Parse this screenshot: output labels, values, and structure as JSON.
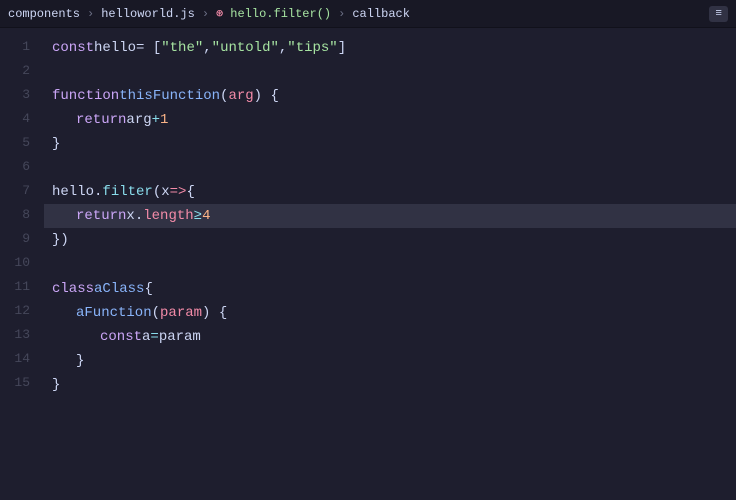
{
  "tabbar": {
    "breadcrumbs": [
      {
        "label": "components",
        "type": "folder"
      },
      {
        "label": "helloworld.js",
        "type": "file"
      },
      {
        "label": "hello.filter()",
        "type": "method"
      },
      {
        "label": "callback",
        "type": "text"
      }
    ],
    "top_right": "≡"
  },
  "lines": [
    {
      "num": 1,
      "tokens": [
        {
          "t": "kw-const",
          "v": "const"
        },
        {
          "t": "var-name",
          "v": " hello "
        },
        {
          "t": "punctuation",
          "v": "= ["
        },
        {
          "t": "string",
          "v": "\"the\""
        },
        {
          "t": "punctuation",
          "v": ", "
        },
        {
          "t": "string",
          "v": "\"untold\""
        },
        {
          "t": "punctuation",
          "v": ", "
        },
        {
          "t": "string",
          "v": "\"tips\""
        },
        {
          "t": "punctuation",
          "v": "]"
        }
      ]
    },
    {
      "num": 2,
      "tokens": []
    },
    {
      "num": 3,
      "tokens": [
        {
          "t": "kw-function",
          "v": "function"
        },
        {
          "t": "fn-name",
          "v": " thisFunction"
        },
        {
          "t": "punctuation",
          "v": "("
        },
        {
          "t": "param",
          "v": "arg"
        },
        {
          "t": "punctuation",
          "v": ") {"
        }
      ]
    },
    {
      "num": 4,
      "tokens": [
        {
          "t": "kw-return",
          "v": "return",
          "indent": 1
        },
        {
          "t": "var-name",
          "v": " arg "
        },
        {
          "t": "operator",
          "v": "+"
        },
        {
          "t": "number",
          "v": " 1"
        }
      ]
    },
    {
      "num": 5,
      "tokens": [
        {
          "t": "punctuation",
          "v": "}"
        }
      ]
    },
    {
      "num": 6,
      "tokens": []
    },
    {
      "num": 7,
      "tokens": [
        {
          "t": "var-name",
          "v": "hello"
        },
        {
          "t": "punctuation",
          "v": "."
        },
        {
          "t": "method",
          "v": "filter"
        },
        {
          "t": "punctuation",
          "v": "("
        },
        {
          "t": "var-name",
          "v": "x"
        },
        {
          "t": "arrow",
          "v": " => "
        },
        {
          "t": "punctuation",
          "v": "{"
        }
      ]
    },
    {
      "num": 8,
      "tokens": [
        {
          "t": "kw-return",
          "v": "return",
          "indent": 1
        },
        {
          "t": "var-name",
          "v": " x"
        },
        {
          "t": "punctuation",
          "v": "."
        },
        {
          "t": "prop",
          "v": "length"
        },
        {
          "t": "operator",
          "v": " ≥ "
        },
        {
          "t": "number",
          "v": "4"
        }
      ],
      "highlight": true
    },
    {
      "num": 9,
      "tokens": [
        {
          "t": "punctuation",
          "v": "})"
        }
      ]
    },
    {
      "num": 10,
      "tokens": []
    },
    {
      "num": 11,
      "tokens": [
        {
          "t": "kw-class",
          "v": "class"
        },
        {
          "t": "fn-name",
          "v": " aClass"
        },
        {
          "t": "punctuation",
          "v": " {"
        }
      ]
    },
    {
      "num": 12,
      "tokens": [
        {
          "t": "fn-name",
          "v": "aFunction",
          "indent": 1
        },
        {
          "t": "punctuation",
          "v": "("
        },
        {
          "t": "param",
          "v": "param"
        },
        {
          "t": "punctuation",
          "v": ") {"
        }
      ]
    },
    {
      "num": 13,
      "tokens": [
        {
          "t": "kw-const",
          "v": "const",
          "indent": 2
        },
        {
          "t": "var-name",
          "v": " a "
        },
        {
          "t": "operator",
          "v": "="
        },
        {
          "t": "var-name",
          "v": " param"
        }
      ]
    },
    {
      "num": 14,
      "tokens": [
        {
          "t": "punctuation",
          "v": "}",
          "indent": 1
        }
      ]
    },
    {
      "num": 15,
      "tokens": [
        {
          "t": "punctuation",
          "v": "}"
        }
      ]
    }
  ]
}
